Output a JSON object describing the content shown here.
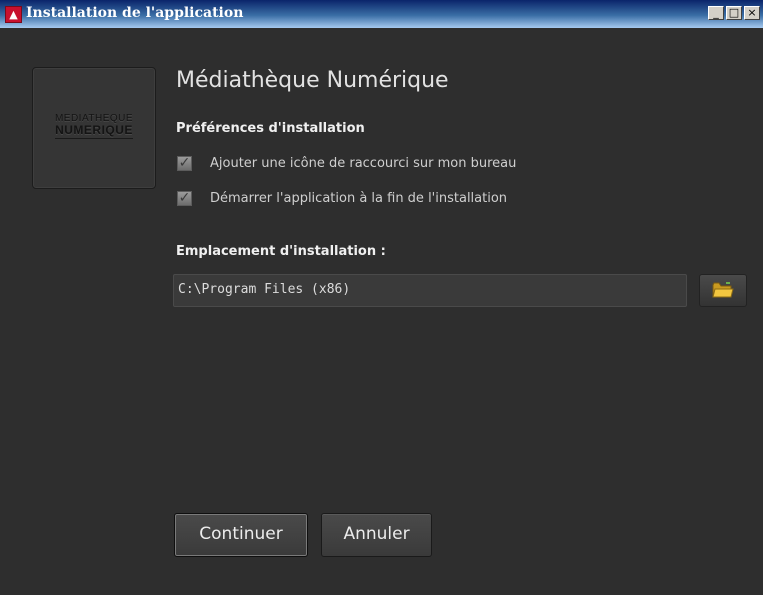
{
  "window": {
    "title": "Installation de l'application",
    "app_icon_glyph": "▲",
    "controls": {
      "minimize": "_",
      "maximize": "□",
      "close": "×"
    }
  },
  "logo": {
    "line1": "MEDIATHEQUE",
    "line2": "NUMERIQUE"
  },
  "app_name": "Médiathèque Numérique",
  "preferences": {
    "heading": "Préférences d'installation",
    "options": [
      {
        "label": "Ajouter une icône de raccourci sur mon bureau",
        "checked": true
      },
      {
        "label": "Démarrer l'application à la fin de l'installation",
        "checked": true
      }
    ]
  },
  "location": {
    "heading": "Emplacement d'installation :",
    "path": "C:\\Program Files (x86)",
    "browse_icon": "folder-icon"
  },
  "buttons": {
    "continue": "Continuer",
    "cancel": "Annuler"
  },
  "colors": {
    "background": "#2e2e2e",
    "title_bar": "#0a246a",
    "text": "#f0f0f0"
  }
}
